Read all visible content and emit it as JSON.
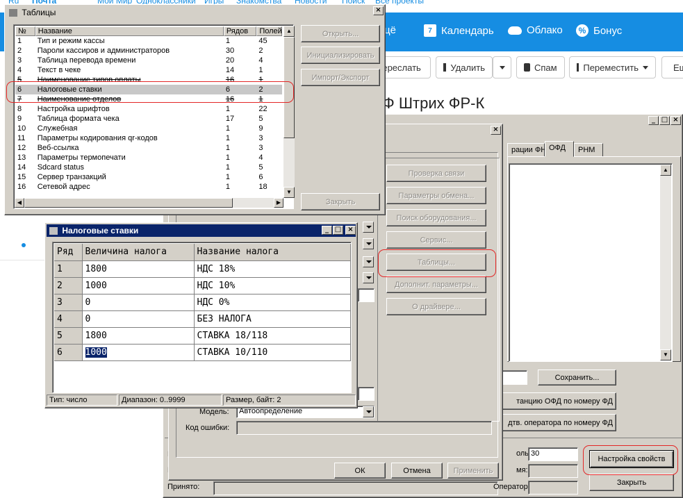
{
  "topnav": {
    "items": [
      "Ru",
      "Почта",
      "Мой Мир",
      "Одноклассники",
      "Игры",
      "Знакомства",
      "Новости",
      "Поиск",
      "Все проекты"
    ]
  },
  "mailbar": {
    "partial": "цё",
    "calendar": "Календарь",
    "calendar_day": "7",
    "cloud": "Облако",
    "bonus": "Бонус"
  },
  "toolbar": {
    "forward": "Переслать",
    "delete": "Удалить",
    "spam": "Спам",
    "move": "Переместить",
    "more": "Ещ"
  },
  "page_heading": "Штрих ФР-К",
  "page_heading_prefix": "Ф",
  "tables_window": {
    "title": "Таблицы",
    "columns": [
      "№",
      "Название",
      "Рядов",
      "Полей"
    ],
    "rows": [
      {
        "n": "1",
        "name": "Тип и режим кассы",
        "rows": "1",
        "fields": "45"
      },
      {
        "n": "2",
        "name": "Пароли кассиров и администраторов",
        "rows": "30",
        "fields": "2"
      },
      {
        "n": "3",
        "name": "Таблица перевода времени",
        "rows": "20",
        "fields": "4"
      },
      {
        "n": "4",
        "name": "Текст в чеке",
        "rows": "14",
        "fields": "1"
      },
      {
        "n": "5",
        "name": "Наименование типов оплаты",
        "rows": "16",
        "fields": "1"
      },
      {
        "n": "6",
        "name": "Налоговые ставки",
        "rows": "6",
        "fields": "2"
      },
      {
        "n": "7",
        "name": "Наименование отделов",
        "rows": "16",
        "fields": "1"
      },
      {
        "n": "8",
        "name": "Настройка шрифтов",
        "rows": "1",
        "fields": "22"
      },
      {
        "n": "9",
        "name": "Таблица формата чека",
        "rows": "17",
        "fields": "5"
      },
      {
        "n": "10",
        "name": "Служебная",
        "rows": "1",
        "fields": "9"
      },
      {
        "n": "11",
        "name": "Параметры кодирования qr-кодов",
        "rows": "1",
        "fields": "3"
      },
      {
        "n": "12",
        "name": "Веб-ссылка",
        "rows": "1",
        "fields": "3"
      },
      {
        "n": "13",
        "name": "Параметры термопечати",
        "rows": "1",
        "fields": "4"
      },
      {
        "n": "14",
        "name": "Sdcard status",
        "rows": "1",
        "fields": "5"
      },
      {
        "n": "15",
        "name": "Сервер транзакций",
        "rows": "1",
        "fields": "6"
      },
      {
        "n": "16",
        "name": "Сетевой адрес",
        "rows": "1",
        "fields": "18"
      }
    ],
    "buttons": {
      "open": "Открыть...",
      "init": "Инициализировать",
      "import_export": "Импорт/Экспорт",
      "close": "Закрыть"
    }
  },
  "tax_window": {
    "title": "Налоговые ставки",
    "columns": [
      "Ряд",
      "Величина налога",
      "Название налога"
    ],
    "rows": [
      {
        "row": "1",
        "value": "1800",
        "name": "НДС 18%"
      },
      {
        "row": "2",
        "value": "1000",
        "name": "НДС 10%"
      },
      {
        "row": "3",
        "value": "0",
        "name": "НДС 0%"
      },
      {
        "row": "4",
        "value": "0",
        "name": "БЕЗ НАЛОГА"
      },
      {
        "row": "5",
        "value": "1800",
        "name": "СТАВКА 18/118"
      },
      {
        "row": "6",
        "value": "1000",
        "name": "СТАВКА 10/110"
      }
    ],
    "status": {
      "type": "Тип: число",
      "range": "Диапазон: 0..9999",
      "size": "Размер, байт: 2"
    }
  },
  "driver_window": {
    "buttons": {
      "check": "Проверка связи",
      "exchange": "Параметры обмена...",
      "search": "Поиск оборудования...",
      "service": "Сервис...",
      "tables": "Таблицы...",
      "extra": "Дополнит. параметры...",
      "about": "О драйвере...",
      "ok": "ОК",
      "cancel": "Отмена",
      "apply": "Применить"
    },
    "model_label": "Модель:",
    "model_value": "Автоопределение",
    "error_label": "Код ошибки:"
  },
  "props_window": {
    "tabs": [
      "рации ФН",
      "ОФД",
      "РНМ"
    ],
    "buttons": {
      "save": "Сохранить...",
      "ofd_by_fd": "танцию ОФД по номеру ФД",
      "op_by_fd": "дтв. оператора по номеру ФД",
      "settings": "Настройка свойств",
      "close": "Закрыть"
    },
    "password_label": "оль:",
    "password_value": "30",
    "time_label": "мя:",
    "operator_label": "Оператор:",
    "received_label": "Принято:"
  }
}
